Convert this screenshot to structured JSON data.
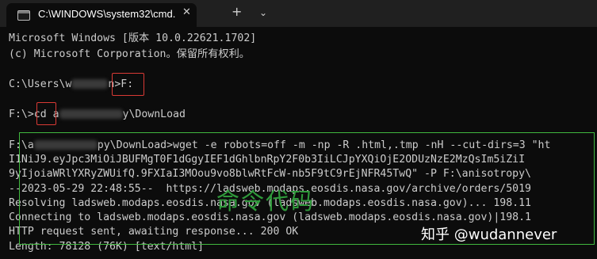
{
  "tab": {
    "title": "C:\\WINDOWS\\system32\\cmd.",
    "close_glyph": "✕",
    "new_tab_glyph": "+",
    "dropdown_glyph": "⌄"
  },
  "terminal": {
    "lines": [
      "Microsoft Windows [版本 10.0.22621.1702]",
      "(c) Microsoft Corporation。保留所有权利。",
      "",
      "C:\\Users\\w",
      "n>F:",
      "",
      "F:\\>cd a",
      "y\\DownLoad",
      "",
      "F:\\a",
      "py\\DownLoad>wget -e robots=off -m -np -R .html,.tmp -nH --cut-dirs=3 \"ht",
      "I1NiJ9.eyJpc3MiOiJBUFMgT0F1dGgyIEF1dGhlbnRpY2F0b3IiLCJpYXQiOjE2ODUzNzE2MzQsIm5iZiI",
      "9yIjoiaWRlYXRyZWUifQ.9FXIaI3MOou9vo8blwRtFcW-nb5F9tC9rEjNFR45TwQ\" -P F:\\anisotropy\\",
      "--2023-05-29 22:48:55--  https://ladsweb.modaps.eosdis.nasa.gov/archive/orders/5019",
      "Resolving ladsweb.modaps.eosdis.nasa.gov (ladsweb.modaps.eosdis.nasa.gov)... 198.11",
      "Connecting to ladsweb.modaps.eosdis.nasa.gov (ladsweb.modaps.eosdis.nasa.gov)|198.1",
      "HTTP request sent, awaiting response... 200 OK",
      "Length: 78128 (76K) [text/html]"
    ]
  },
  "annotation": {
    "label": "命令代码",
    "red_color": "#d93a35",
    "green_color": "#41b83f"
  },
  "watermark": "知乎 @wudannever"
}
